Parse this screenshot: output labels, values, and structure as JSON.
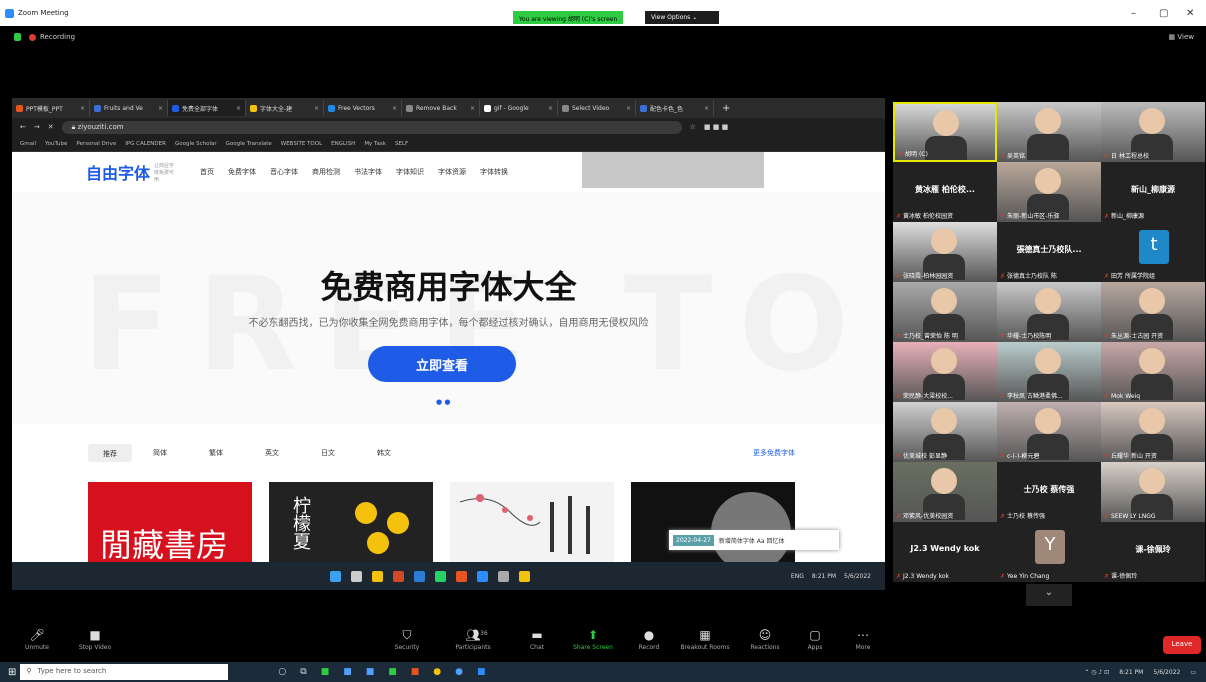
{
  "zoom": {
    "title": "Zoom Meeting",
    "share_banner": "You are viewing 胡明 (C)'s screen",
    "view_options": "View Options ⌄",
    "recording": "Recording",
    "view": "View",
    "min": "–",
    "max": "▢",
    "close": "✕"
  },
  "browser": {
    "tabs": [
      {
        "label": "PPT模板_PPT",
        "color": "#e8541e"
      },
      {
        "label": "Fruits and Ve",
        "color": "#3b6fd8"
      },
      {
        "label": "免费全部字体",
        "color": "#1e5be6"
      },
      {
        "label": "字体大全-建",
        "color": "#f4c20d"
      },
      {
        "label": "Free Vectors",
        "color": "#1e88e5"
      },
      {
        "label": "Remove Back",
        "color": "#888888"
      },
      {
        "label": "gif - Google",
        "color": "#ffffff"
      },
      {
        "label": "Select Video",
        "color": "#888888"
      },
      {
        "label": "配色卡色_色",
        "color": "#3b6fd8"
      }
    ],
    "new_tab": "+",
    "url": "ziyouziti.com",
    "bookmarks": [
      "Gmail",
      "YouTube",
      "Personal Drive",
      "IPG CALENDER",
      "Google Scholar",
      "Google Translate",
      "WEBSITE TOOL",
      "ENGLISH",
      "My Task",
      "SELF"
    ]
  },
  "site": {
    "logo": "自由字体",
    "logo_sub": "让商业字体免费可用",
    "nav": [
      "首页",
      "免费字体",
      "音心字体",
      "商用检测",
      "书法字体",
      "字体知识",
      "字体资源",
      "字体转换"
    ],
    "watermark": "FREE TO",
    "hero_title": "免费商用字体大全",
    "hero_sub": "不必东翻西找，已为你收集全网免费商用字体，每个都经过核对确认，自用商用无侵权风险",
    "hero_button": "立即查看",
    "dots": "● ●",
    "categories": [
      "推荐",
      "简体",
      "繁体",
      "英文",
      "日文",
      "韩文"
    ],
    "more": "更多免费字体",
    "card1_text": "閒藏書房",
    "card2_text": "柠檬夏",
    "toast_tag": "2022-04-27",
    "toast_text": "新增简体字体 Aa 回忆体"
  },
  "shared_taskbar": {
    "lang": "ENG",
    "time": "8:21 PM",
    "date": "5/6/2022"
  },
  "participants": [
    {
      "name": "胡明 (C)",
      "mode": "video",
      "bg": "#d8d8d8",
      "active": true
    },
    {
      "name": "吴英铭",
      "mode": "video",
      "bg": "#c9c9c9"
    },
    {
      "name": "日 林工程总校",
      "mode": "video",
      "bg": "#bcbcbc"
    },
    {
      "name": "黄冰敏 柏伦校园资",
      "mode": "name",
      "big": "黄冰雁 柏伦校..."
    },
    {
      "name": "朱丽-新山市区-乐驿",
      "mode": "video",
      "bg": "#b9a89a"
    },
    {
      "name": "新山_柳康源",
      "mode": "name",
      "big": "新山_柳康源"
    },
    {
      "name": "张晓霞-柏林园园资",
      "mode": "video",
      "bg": "#ddd"
    },
    {
      "name": "张德真士乃校队 陈",
      "mode": "name",
      "big": "張德真士乃校队..."
    },
    {
      "name": "田芳 所属学院组",
      "mode": "avatar",
      "letter": "t",
      "color": "#1e88c8"
    },
    {
      "name": "士乃校_曾荣怡 陈 明",
      "mode": "video",
      "bg": "#aaa"
    },
    {
      "name": "华耀-士乃校陈明",
      "mode": "video",
      "bg": "#c8c8c8"
    },
    {
      "name": "朱丛源-士古园 开资",
      "mode": "video",
      "bg": "#b8a8a0"
    },
    {
      "name": "荣民静-大梁校校...",
      "mode": "video",
      "bg": "#e8b0b8"
    },
    {
      "name": "李秋凤 古鳞港柔佛...",
      "mode": "video",
      "bg": "#bcc"
    },
    {
      "name": "Mok Weiq",
      "mode": "video",
      "bg": "#c8a8a8"
    },
    {
      "name": "优美城校 彭显静",
      "mode": "video",
      "bg": "#d0d0d0"
    },
    {
      "name": "c-(-)-柳元碧",
      "mode": "video",
      "bg": "#c0b0b0"
    },
    {
      "name": "丘耀华 新山 开资",
      "mode": "video",
      "bg": "#d8c8c0"
    },
    {
      "name": "邓紫风-优美校园资",
      "mode": "video",
      "bg": "#6a7060"
    },
    {
      "name": "士乃校 蔡传强",
      "mode": "name",
      "big": "士乃校 蔡传强"
    },
    {
      "name": "SEEW LY LNGG",
      "mode": "video",
      "bg": "#d8d0c8"
    },
    {
      "name": "J2.3 Wendy kok",
      "mode": "name",
      "big": "J2.3 Wendy kok"
    },
    {
      "name": "Yee Yin Chang",
      "mode": "avatar",
      "letter": "Y",
      "color": "#a08878"
    },
    {
      "name": "课-徐佩玲",
      "mode": "name",
      "big": "课-徐佩玲"
    }
  ],
  "controls": [
    {
      "label": "Unmute",
      "icon": "🎤︎"
    },
    {
      "label": "Stop Video",
      "icon": "■"
    },
    {
      "label": "Security",
      "icon": "⛉"
    },
    {
      "label": "Participants",
      "icon": "👥︎"
    },
    {
      "label": "Chat",
      "icon": "▬"
    },
    {
      "label": "Share Screen",
      "icon": "⬆"
    },
    {
      "label": "Record",
      "icon": "●"
    },
    {
      "label": "Breakout Rooms",
      "icon": "▦"
    },
    {
      "label": "Reactions",
      "icon": "☺"
    },
    {
      "label": "Apps",
      "icon": "▢"
    },
    {
      "label": "More",
      "icon": "⋯"
    }
  ],
  "participant_count": "36",
  "leave": "Leave",
  "win_taskbar": {
    "search": "Type here to search",
    "time": "8:21 PM",
    "date": "5/6/2022"
  }
}
